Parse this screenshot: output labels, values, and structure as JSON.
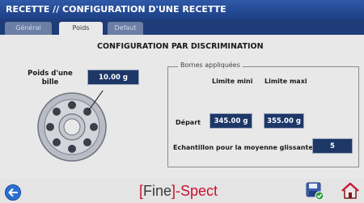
{
  "window": {
    "title": "RECETTE // CONFIGURATION D'UNE RECETTE"
  },
  "tabs": [
    {
      "label": "Général",
      "active": false
    },
    {
      "label": "Poids",
      "active": true
    },
    {
      "label": "Defaut",
      "active": false
    }
  ],
  "main": {
    "heading": "CONFIGURATION PAR DISCRIMINATION",
    "poids_label": "Poids d'une bille",
    "poids_value": "10.00 g"
  },
  "bornes": {
    "title": "Bornes appliquées",
    "col_min": "Limite mini",
    "col_max": "Limite maxi",
    "depart_label": "Départ",
    "depart_min": "345.00 g",
    "depart_max": "355.00 g",
    "echantillon_label": "Echantillon pour la moyenne glissante",
    "echantillon_value": "5"
  },
  "footer": {
    "brand_open": "[",
    "brand_fine": "Fine",
    "brand_close": "]-Spect"
  },
  "colors": {
    "titlebar": "#2f59a8",
    "value_box": "#1d3767",
    "brand_red": "#c8102e"
  }
}
